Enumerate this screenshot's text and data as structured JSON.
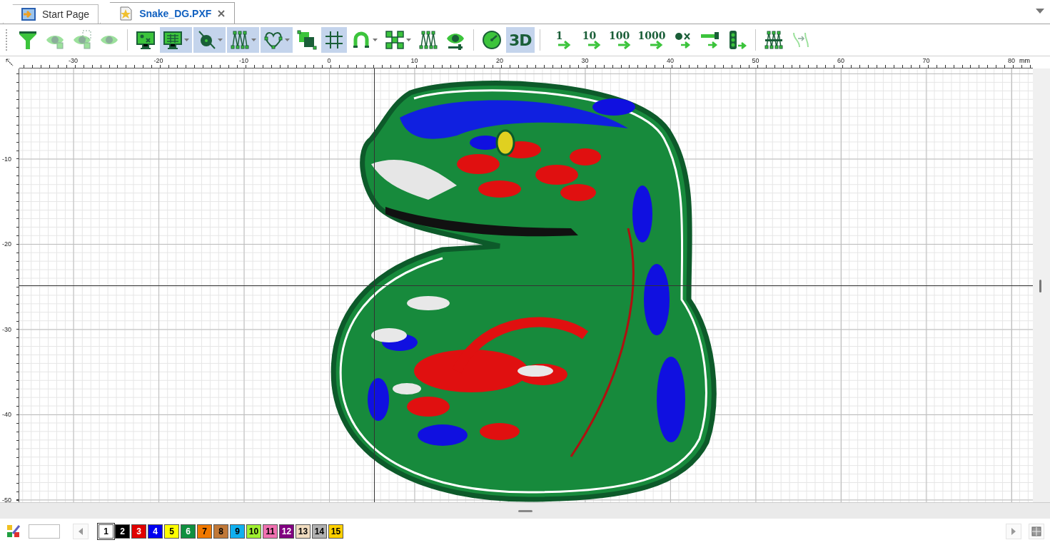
{
  "tabs": [
    {
      "label": "Start Page",
      "selected": false,
      "closable": false
    },
    {
      "label": "Snake_DG.PXF",
      "selected": true,
      "closable": true
    }
  ],
  "toolbar": [
    [
      {
        "kind": "filter",
        "selected": false,
        "dropdown": false,
        "disabled": false
      },
      {
        "kind": "eye-x",
        "selected": false,
        "dropdown": false,
        "disabled": true
      },
      {
        "kind": "eye-box",
        "selected": false,
        "dropdown": false,
        "disabled": true
      },
      {
        "kind": "eye",
        "selected": false,
        "dropdown": false,
        "disabled": true
      }
    ],
    [
      {
        "kind": "monitor-x",
        "selected": false,
        "dropdown": false,
        "disabled": false
      },
      {
        "kind": "monitor-grid",
        "selected": true,
        "dropdown": true,
        "disabled": false
      },
      {
        "kind": "node",
        "selected": true,
        "dropdown": true,
        "disabled": false
      },
      {
        "kind": "stitches",
        "selected": true,
        "dropdown": true,
        "disabled": false
      },
      {
        "kind": "heart",
        "selected": true,
        "dropdown": true,
        "disabled": false
      },
      {
        "kind": "squares",
        "selected": false,
        "dropdown": false,
        "disabled": false
      },
      {
        "kind": "grid",
        "selected": true,
        "dropdown": false,
        "disabled": false
      },
      {
        "kind": "magnet",
        "selected": false,
        "dropdown": true,
        "disabled": false
      },
      {
        "kind": "cross-squares",
        "selected": false,
        "dropdown": true,
        "disabled": false
      },
      {
        "kind": "stitches",
        "selected": false,
        "dropdown": false,
        "disabled": false
      },
      {
        "kind": "eye-slider",
        "selected": false,
        "dropdown": false,
        "disabled": false
      }
    ],
    [
      {
        "kind": "gauge",
        "selected": false,
        "dropdown": false,
        "disabled": false
      },
      {
        "kind": "label",
        "label": "3D",
        "selected": true,
        "dropdown": false,
        "disabled": false
      }
    ],
    [
      {
        "kind": "step",
        "label": "1",
        "selected": false,
        "dropdown": false,
        "disabled": false
      },
      {
        "kind": "step",
        "label": "10",
        "selected": false,
        "dropdown": false,
        "disabled": false
      },
      {
        "kind": "step",
        "label": "100",
        "selected": false,
        "dropdown": false,
        "disabled": false
      },
      {
        "kind": "step",
        "label": "1000",
        "selected": false,
        "dropdown": false,
        "disabled": false
      },
      {
        "kind": "dot-x",
        "selected": false,
        "dropdown": false,
        "disabled": false
      },
      {
        "kind": "bar",
        "selected": false,
        "dropdown": false,
        "disabled": false
      },
      {
        "kind": "lights",
        "selected": false,
        "dropdown": false,
        "disabled": false
      }
    ],
    [
      {
        "kind": "stitches-bar",
        "selected": false,
        "dropdown": false,
        "disabled": false
      },
      {
        "kind": "swap",
        "selected": false,
        "dropdown": false,
        "disabled": true
      }
    ]
  ],
  "ruler": {
    "unit": "mm",
    "x_labels": [
      "-30",
      "-20",
      "-10",
      "0",
      "10",
      "20",
      "30",
      "40",
      "50",
      "60",
      "70",
      "80"
    ],
    "y_labels": [
      "-10",
      "-20",
      "-30",
      "-40",
      "-50"
    ]
  },
  "colors": [
    {
      "label": "1",
      "color": "#ffffff",
      "selected": true
    },
    {
      "label": "2",
      "color": "#000000",
      "selected": false
    },
    {
      "label": "3",
      "color": "#e00000",
      "selected": false
    },
    {
      "label": "4",
      "color": "#0000f0",
      "selected": false
    },
    {
      "label": "5",
      "color": "#ffff00",
      "selected": false
    },
    {
      "label": "6",
      "color": "#109040",
      "selected": false
    },
    {
      "label": "7",
      "color": "#f07800",
      "selected": false
    },
    {
      "label": "8",
      "color": "#c07838",
      "selected": false
    },
    {
      "label": "9",
      "color": "#10b0f0",
      "selected": false
    },
    {
      "label": "10",
      "color": "#a0f030",
      "selected": false
    },
    {
      "label": "11",
      "color": "#f070b0",
      "selected": false
    },
    {
      "label": "12",
      "color": "#800080",
      "selected": false
    },
    {
      "label": "13",
      "color": "#f0dcc0",
      "selected": false
    },
    {
      "label": "14",
      "color": "#b0b0b0",
      "selected": false
    },
    {
      "label": "15",
      "color": "#ffd000",
      "selected": false
    }
  ]
}
